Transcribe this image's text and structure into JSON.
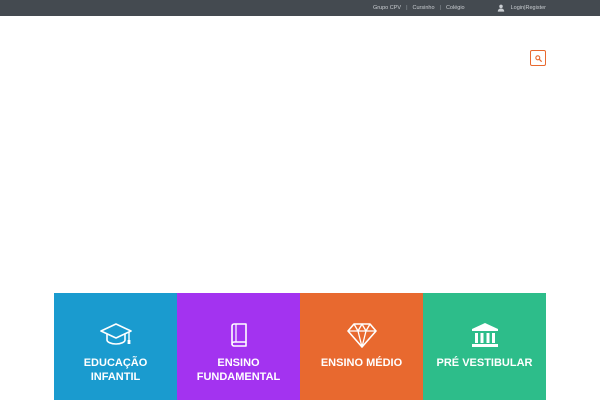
{
  "topbar": {
    "links": [
      "Grupo CPV",
      "Cursinho",
      "Colégio"
    ],
    "separator": "|",
    "login_label": "Login",
    "register_label": "Register",
    "user_icon": "user-icon"
  },
  "search": {
    "icon": "search-icon"
  },
  "colors": {
    "topbar_bg": "#444a50",
    "accent": "#e8692f",
    "tile_1": "#1a9bcf",
    "tile_2": "#a333f0",
    "tile_3": "#e8692f",
    "tile_4": "#2dbd8a"
  },
  "tiles": [
    {
      "line1": "EDUCAÇÃO",
      "line2": "INFANTIL",
      "icon": "graduation-cap-icon"
    },
    {
      "line1": "ENSINO",
      "line2": "FUNDAMENTAL",
      "icon": "book-icon"
    },
    {
      "line1": "ENSINO MÉDIO",
      "line2": "",
      "icon": "diamond-icon"
    },
    {
      "line1": "PRÉ VESTIBULAR",
      "line2": "",
      "icon": "institution-icon"
    }
  ]
}
